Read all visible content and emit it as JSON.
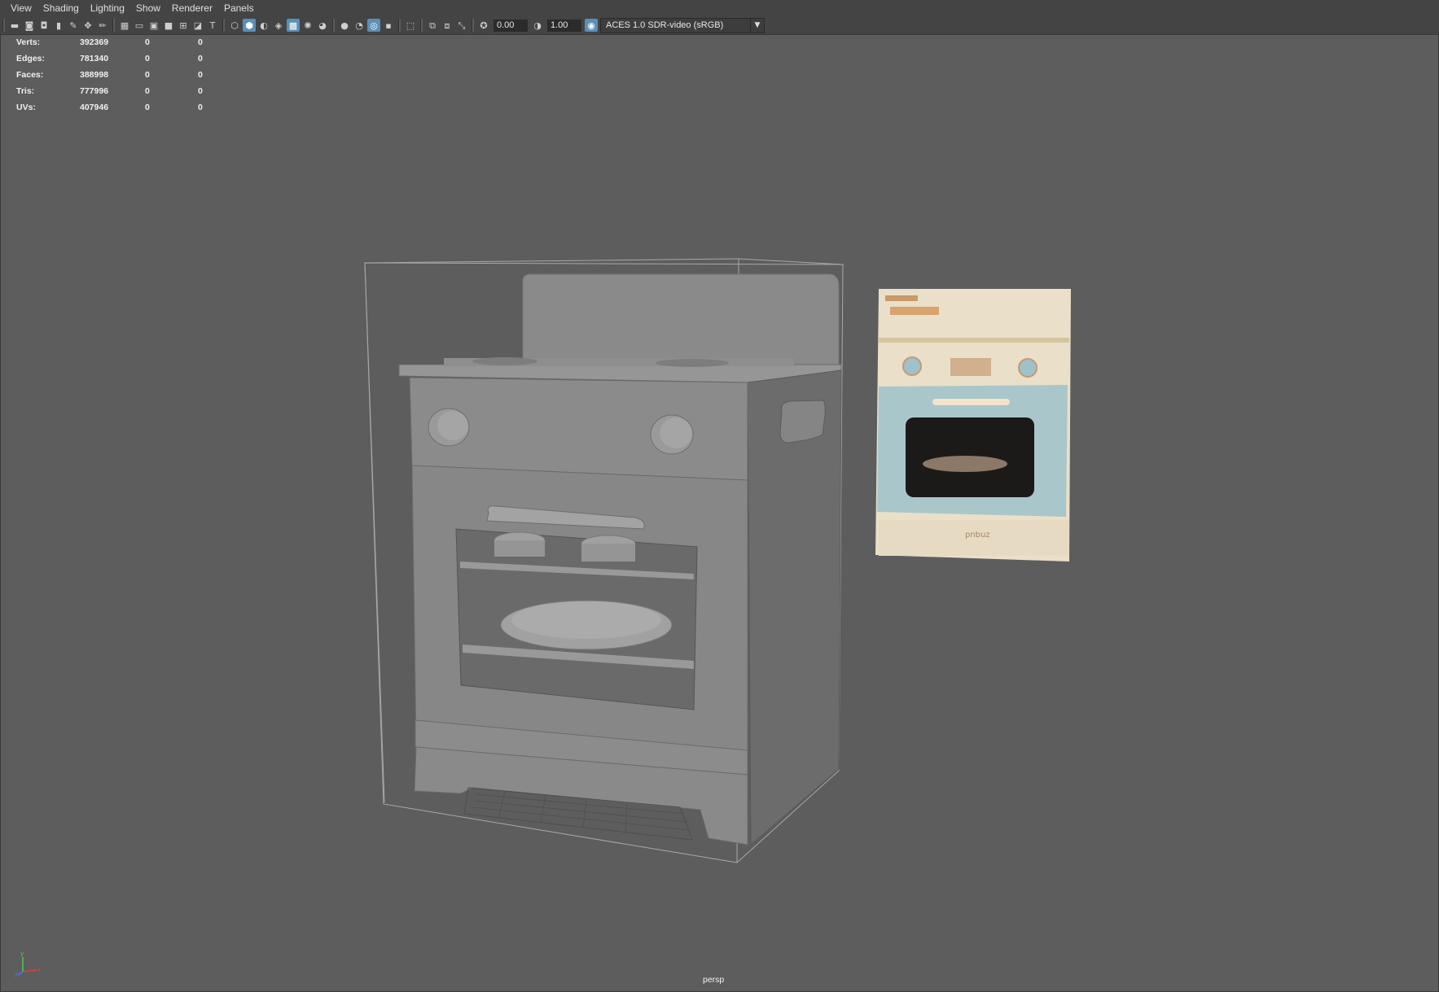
{
  "menu": {
    "items": [
      "View",
      "Shading",
      "Lighting",
      "Show",
      "Renderer",
      "Panels"
    ]
  },
  "toolbar": {
    "exposure": "0.00",
    "gamma": "1.00",
    "color_transform": "ACES 1.0 SDR-video (sRGB)"
  },
  "hud": {
    "rows": [
      {
        "label": "Verts:",
        "value": "392369",
        "a": "0",
        "b": "0"
      },
      {
        "label": "Edges:",
        "value": "781340",
        "a": "0",
        "b": "0"
      },
      {
        "label": "Faces:",
        "value": "388998",
        "a": "0",
        "b": "0"
      },
      {
        "label": "Tris:",
        "value": "777996",
        "a": "0",
        "b": "0"
      },
      {
        "label": "UVs:",
        "value": "407946",
        "a": "0",
        "b": "0"
      }
    ]
  },
  "viewport": {
    "camera": "persp"
  },
  "reference_image": {
    "brand_text": "pnbuz"
  },
  "colors": {
    "background": "#5d5d5d",
    "ui_panel": "#444444",
    "accent": "#5b8fb6",
    "model_grey": "#858585",
    "ref_blue": "#a9c6cb",
    "ref_cream": "#e9dcc4"
  }
}
